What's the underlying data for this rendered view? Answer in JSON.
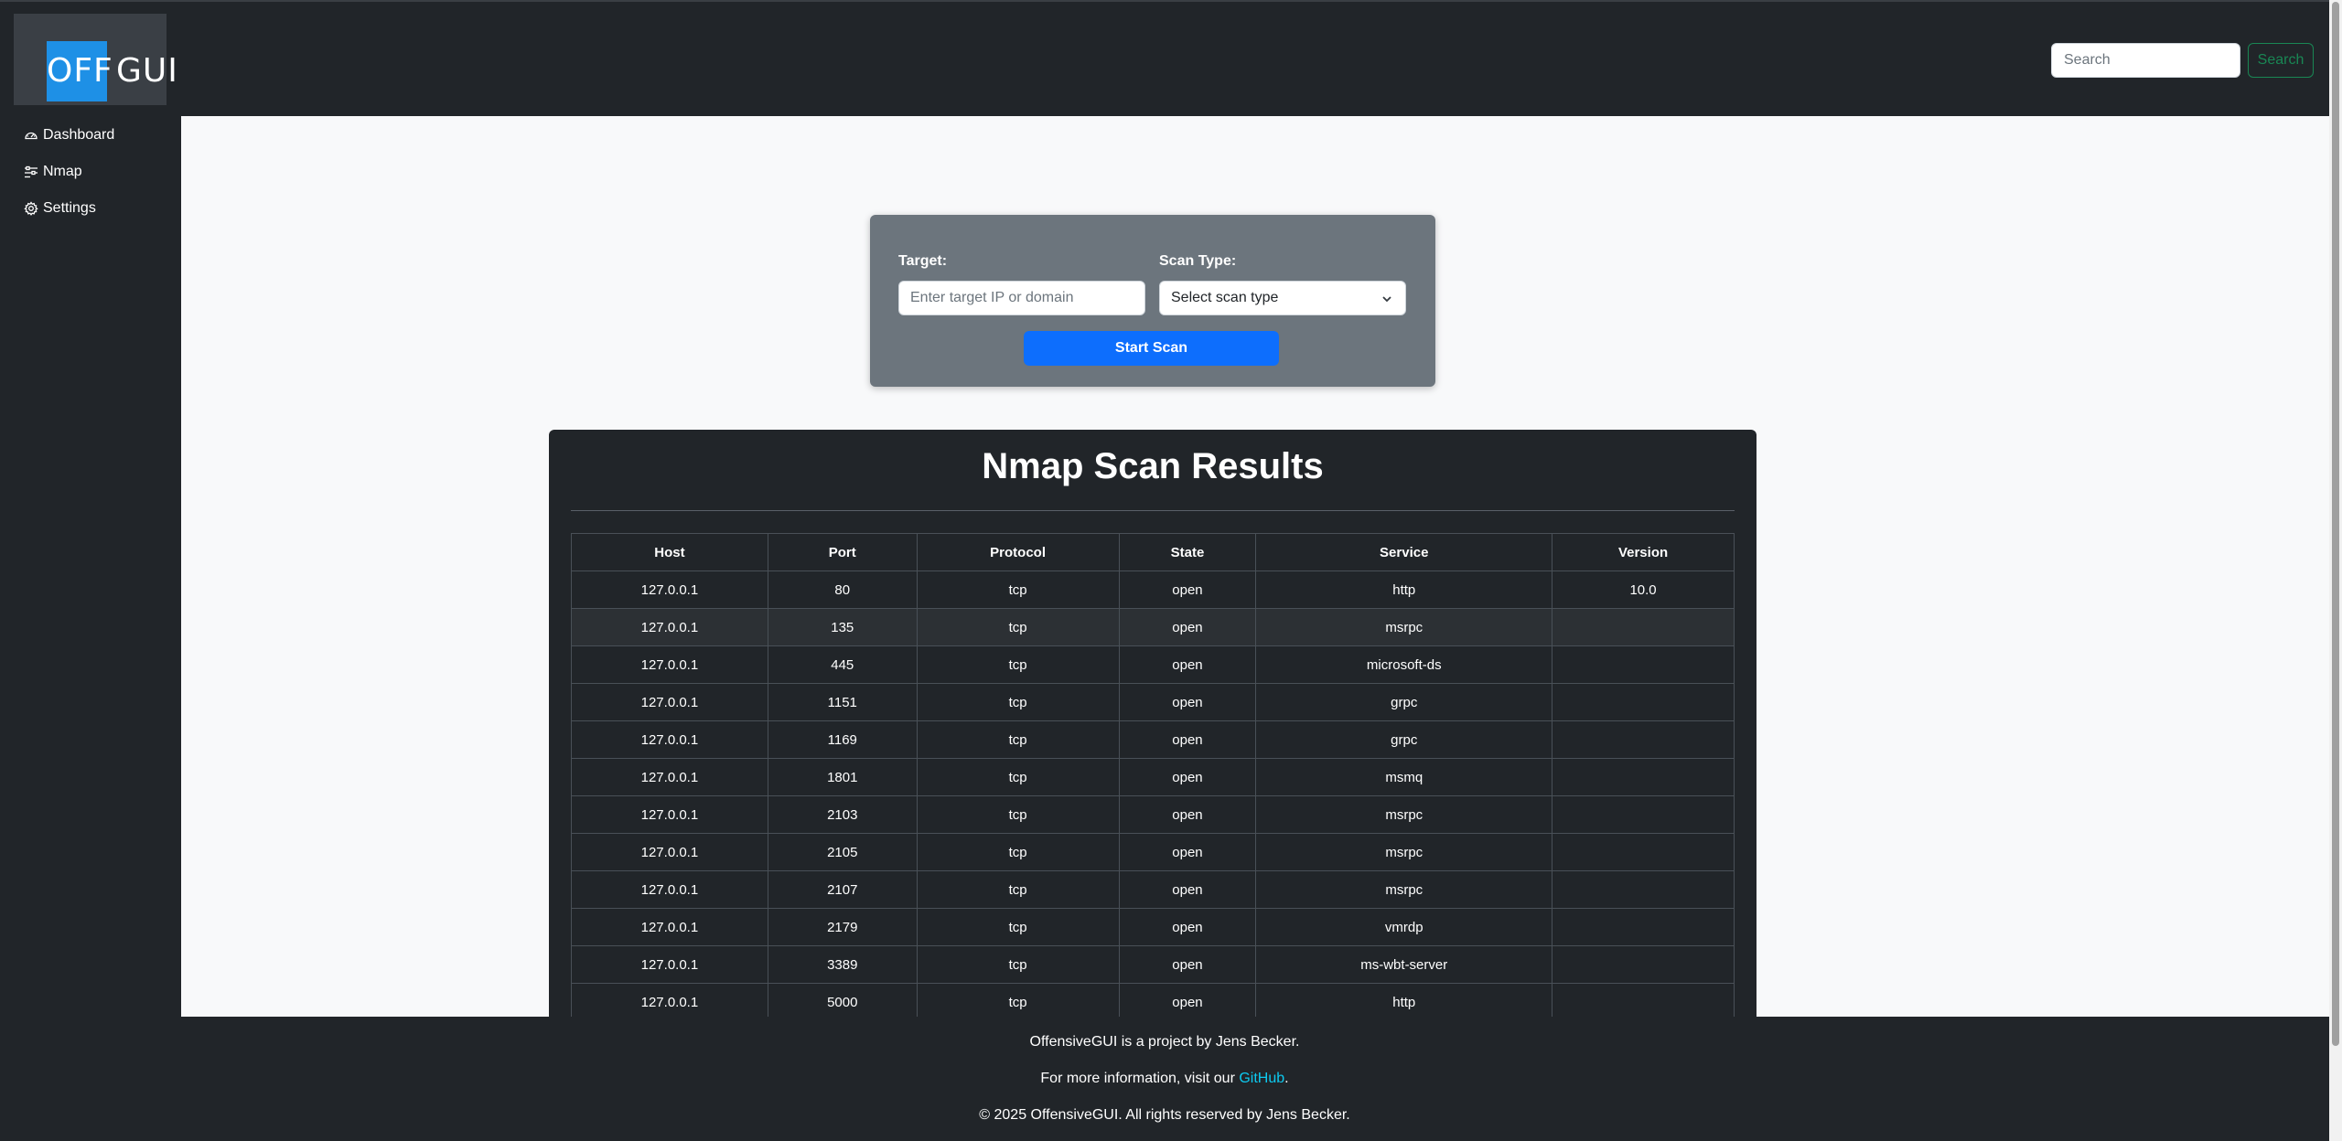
{
  "brand": {
    "logo_left": "OFF",
    "logo_right": "GUI"
  },
  "search": {
    "placeholder": "Search",
    "button_label": "Search"
  },
  "sidebar": {
    "items": [
      {
        "label": "Dashboard",
        "icon": "speedometer-icon"
      },
      {
        "label": "Nmap",
        "icon": "sliders-icon"
      },
      {
        "label": "Settings",
        "icon": "gear-icon"
      }
    ]
  },
  "scan_form": {
    "target_label": "Target:",
    "target_placeholder": "Enter target IP or domain",
    "scan_type_label": "Scan Type:",
    "scan_type_selected": "Select scan type",
    "start_button": "Start Scan"
  },
  "results": {
    "title": "Nmap Scan Results",
    "columns": [
      "Host",
      "Port",
      "Protocol",
      "State",
      "Service",
      "Version"
    ],
    "rows": [
      [
        "127.0.0.1",
        "80",
        "tcp",
        "open",
        "http",
        "10.0"
      ],
      [
        "127.0.0.1",
        "135",
        "tcp",
        "open",
        "msrpc",
        ""
      ],
      [
        "127.0.0.1",
        "445",
        "tcp",
        "open",
        "microsoft-ds",
        ""
      ],
      [
        "127.0.0.1",
        "1151",
        "tcp",
        "open",
        "grpc",
        ""
      ],
      [
        "127.0.0.1",
        "1169",
        "tcp",
        "open",
        "grpc",
        ""
      ],
      [
        "127.0.0.1",
        "1801",
        "tcp",
        "open",
        "msmq",
        ""
      ],
      [
        "127.0.0.1",
        "2103",
        "tcp",
        "open",
        "msrpc",
        ""
      ],
      [
        "127.0.0.1",
        "2105",
        "tcp",
        "open",
        "msrpc",
        ""
      ],
      [
        "127.0.0.1",
        "2107",
        "tcp",
        "open",
        "msrpc",
        ""
      ],
      [
        "127.0.0.1",
        "2179",
        "tcp",
        "open",
        "vmrdp",
        ""
      ],
      [
        "127.0.0.1",
        "3389",
        "tcp",
        "open",
        "ms-wbt-server",
        ""
      ],
      [
        "127.0.0.1",
        "5000",
        "tcp",
        "open",
        "http",
        ""
      ]
    ]
  },
  "footer": {
    "line1": "OffensiveGUI is a project by Jens Becker.",
    "line2_prefix": "For more information, visit our ",
    "line2_link": "GitHub",
    "line2_suffix": ".",
    "line3": "© 2025 OffensiveGUI. All rights reserved by Jens Becker."
  },
  "colors": {
    "background": "#212529",
    "main_bg": "#f8f9fa",
    "primary": "#0d6efd",
    "success": "#198754",
    "card_gray": "#6c757d",
    "logo_blue": "#1e90e6",
    "link": "#0dcaf0"
  }
}
